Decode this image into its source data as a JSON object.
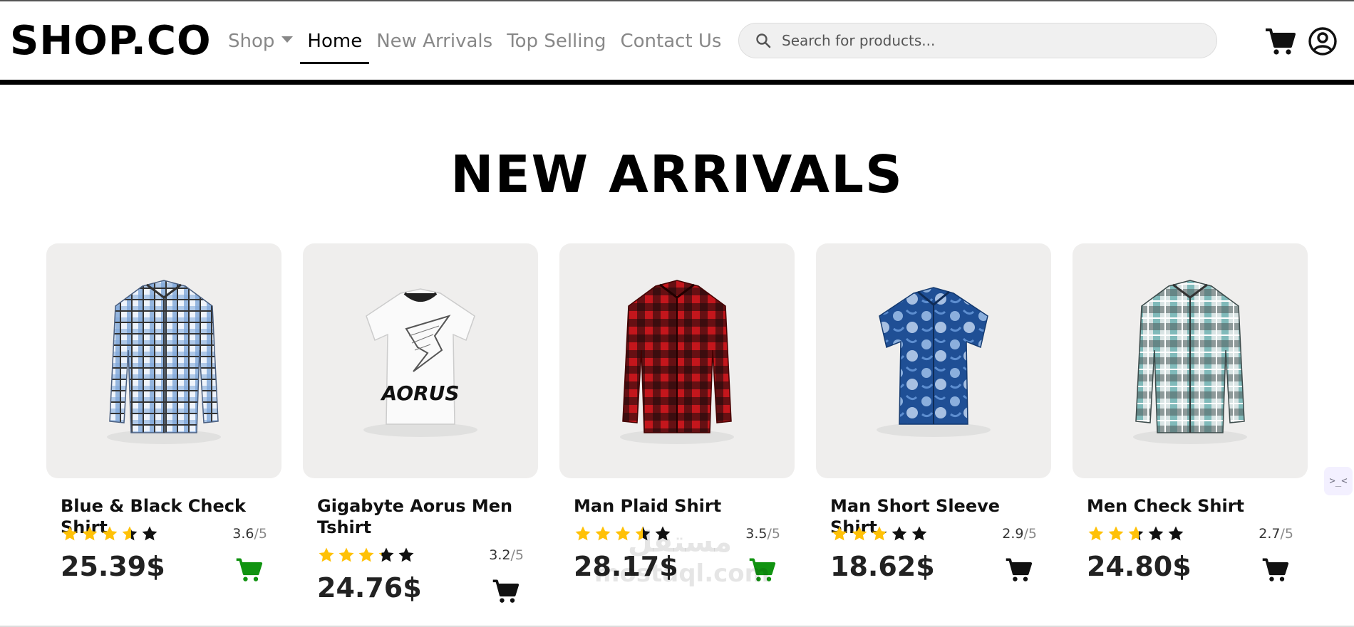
{
  "brand": {
    "logo": "SHOP.CO"
  },
  "nav": {
    "items": [
      {
        "label": "Shop",
        "has_dropdown": true,
        "active": false
      },
      {
        "label": "Home",
        "active": true
      },
      {
        "label": "New Arrivals",
        "active": false
      },
      {
        "label": "Top Selling",
        "active": false
      },
      {
        "label": "Contact Us",
        "active": false
      }
    ]
  },
  "search": {
    "placeholder": "Search for products...",
    "value": "",
    "icon": "search-icon"
  },
  "header_icons": {
    "cart": "cart-icon",
    "account": "user-circle-icon"
  },
  "section": {
    "title": "NEW ARRIVALS"
  },
  "products": [
    {
      "name": "Blue & Black Check Shirt",
      "rating": 3.6,
      "rating_text": "3.6",
      "rating_max": "/5",
      "price": "25.39$",
      "cart_color": "#119311",
      "image": "shirt-blue-check"
    },
    {
      "name": "Gigabyte Aorus Men Tshirt",
      "rating": 3.2,
      "rating_text": "3.2",
      "rating_max": "/5",
      "price": "24.76$",
      "cart_color": "#111111",
      "image": "tshirt-aorus",
      "image_text": "AORUS"
    },
    {
      "name": "Man Plaid Shirt",
      "rating": 3.5,
      "rating_text": "3.5",
      "rating_max": "/5",
      "price": "28.17$",
      "cart_color": "#119311",
      "image": "shirt-red-plaid"
    },
    {
      "name": "Man Short Sleeve Shirt",
      "rating": 2.9,
      "rating_text": "2.9",
      "rating_max": "/5",
      "price": "18.62$",
      "cart_color": "#111111",
      "image": "shirt-blue-floral"
    },
    {
      "name": "Men Check Shirt",
      "rating": 2.7,
      "rating_text": "2.7",
      "rating_max": "/5",
      "price": "24.80$",
      "cart_color": "#111111",
      "image": "shirt-teal-check"
    }
  ],
  "colors": {
    "star_filled": "#FFC107",
    "star_empty": "#111111",
    "nav_inactive": "#888888",
    "image_bg": "#EFEEED"
  },
  "watermark": {
    "text": "mostaql.com",
    "logo_text": "مستقل"
  }
}
